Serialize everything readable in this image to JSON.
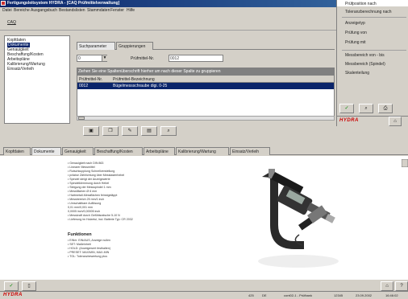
{
  "window": {
    "title": "Fertigungsleitsystem HYDRA - [CAQ Prüfmittelverwaltung]"
  },
  "menu": [
    "Datei",
    "Bereiche",
    "Ausgangsbuch",
    "Bestandslisten",
    "Stammdaten",
    "Fenster",
    "Hilfe"
  ],
  "toolbar": {
    "cad_label": "CAQ"
  },
  "nav": {
    "items": [
      "Kopfdaten",
      "Dokumente",
      "Genauigkeit",
      "Beschaffung/Kosten",
      "Arbeitspläne",
      "Kalibrierung/Wartung",
      "Einsatz/Verleih"
    ],
    "selected": 1
  },
  "search": {
    "tabs": [
      "Suchparameter",
      "Gruppierungen"
    ],
    "select_value": "0",
    "field_label": "Prüfmittel-Nr.",
    "field_value": "0012",
    "hint": "Ziehen Sie eine Spaltenüberschrift hierher um nach dieser Spalte zu gruppieren",
    "columns": [
      "Prüfmittel-Nr.",
      "Prüfmittel-Bezeichnung"
    ],
    "rows": [
      [
        "0012",
        "Bügelmessschraube digi. 0-25"
      ]
    ]
  },
  "dialog": {
    "items_top": [
      "Prüfposition nach",
      "Toleranzberechnung nach"
    ],
    "items_mid": [
      "Anzeigetyp",
      "Prüfung von",
      "Prüfung mit"
    ],
    "items_bot": [
      "Messbereich von - bis",
      "Messbereich (Spindel)",
      "Skalenteilung"
    ],
    "logo": "HYDRA"
  },
  "lower": {
    "tabs": [
      "Kopfdaten",
      "Dokumente",
      "Genauigkeit",
      "Beschaffung/Kosten",
      "Arbeitspläne",
      "Kalibrierung/Wartung",
      "Einsatz/Verleih"
    ],
    "selected_tab": 1,
    "doc_lines": [
      "• Genauigkeit nach DIN 863",
      "• Linearer Messmittel",
      "• Rutschkupplung Schnellverstellung",
      "• präzise Zählrichtung über Messtasterhebel",
      "• Spindel steigt der Anzeigewerte",
      "• Spindelklemmung durch Hebel",
      "• Steigung der Messspindel 1 mm",
      "• Messflächen Ø 6 mm",
      "• Hartmetall-Messflächen feinstgeläppt",
      "• Messbereich 25 mm/1 inch",
      "• Umschaltbare Auflösung",
      "0,01 mm/0,001 mm",
      "0,0005 inch/0,00005 inch",
      "• Messkraft durch Gefühlsratsche 5-10 N",
      "• Lieferung im Holzetui, incl. Batterie Typ: CR 2032"
    ],
    "doc_heading": "Funktionen",
    "func_lines": [
      "• EIN/n: EIN/AUS, Anzeige nullen",
      "• SET: Maßeinheit",
      "• HOLD: (Anzeigewert festhalten)",
      "• PRESET: MAX/MIN, MAX-MIN",
      "• TOL: Toleranzbewertung plus"
    ]
  },
  "status": {
    "logo": "HYDRA",
    "fields": [
      "425",
      "DE",
      "cont02-1 - Prüfbank",
      "12345",
      "23.09.2002",
      "16:46:02"
    ]
  }
}
